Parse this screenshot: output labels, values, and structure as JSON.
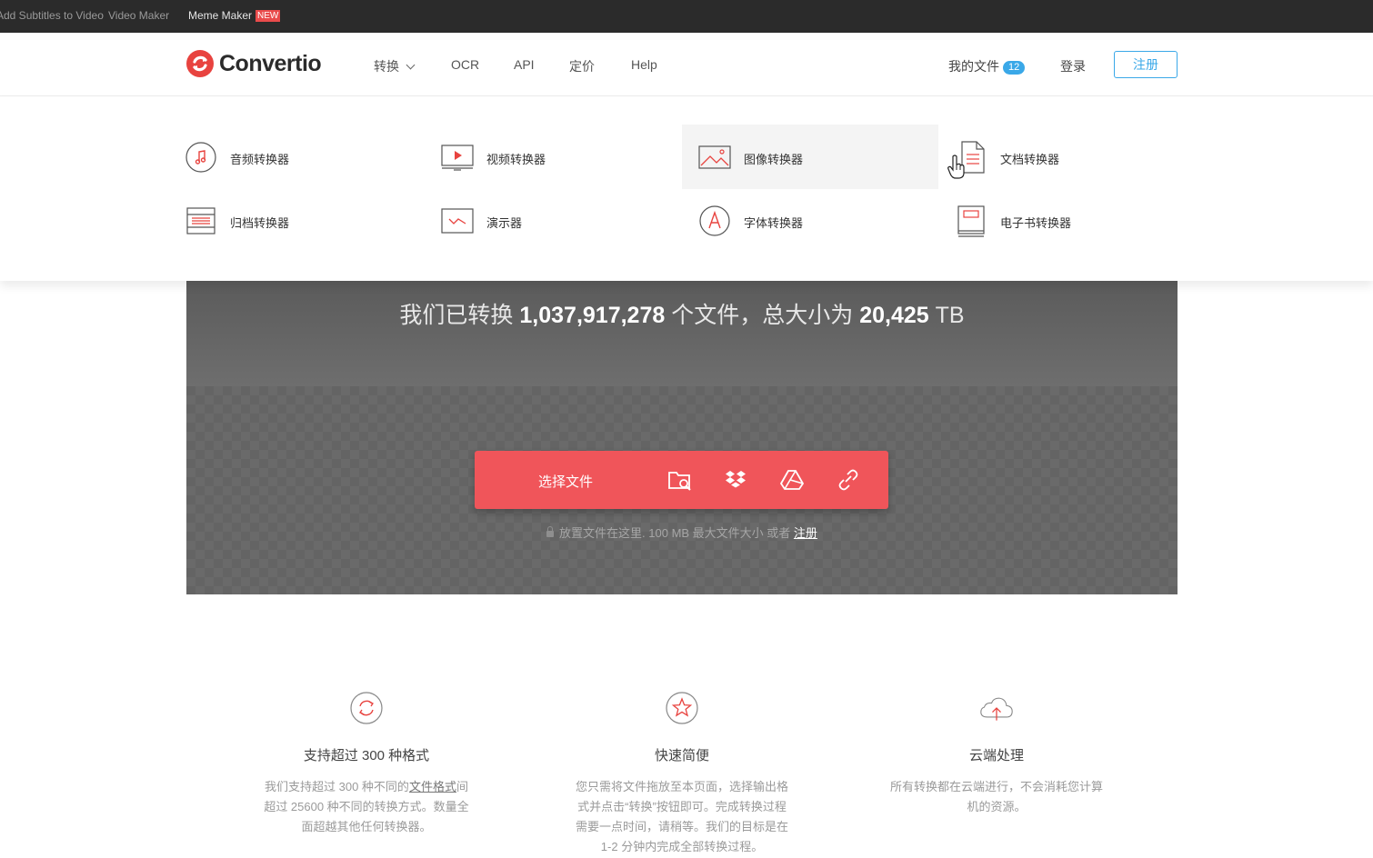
{
  "topbar": {
    "links": [
      "Add Subtitles to Video",
      "Video Maker",
      "Meme Maker"
    ],
    "new_badge": "NEW"
  },
  "header": {
    "brand": "Convertio",
    "nav": {
      "convert": "转换",
      "ocr": "OCR",
      "api": "API",
      "pricing": "定价",
      "help": "Help"
    },
    "my_files": "我的文件",
    "my_files_count": "12",
    "login": "登录",
    "signup": "注册"
  },
  "dropdown": {
    "items": [
      {
        "label": "音频转换器",
        "icon": "music-note-icon"
      },
      {
        "label": "视频转换器",
        "icon": "video-play-icon"
      },
      {
        "label": "图像转换器",
        "icon": "image-icon"
      },
      {
        "label": "文档转换器",
        "icon": "document-icon"
      },
      {
        "label": "归档转换器",
        "icon": "archive-icon"
      },
      {
        "label": "演示器",
        "icon": "presentation-icon"
      },
      {
        "label": "字体转换器",
        "icon": "font-icon"
      },
      {
        "label": "电子书转换器",
        "icon": "ebook-icon"
      }
    ]
  },
  "hero": {
    "stats_prefix": "我们已转换",
    "files_count": "1,037,917,278",
    "stats_mid": "个文件，总大小为",
    "total_size": "20,425",
    "size_unit": "TB",
    "choose_files": "选择文件",
    "hint_text": "放置文件在这里. 100 MB 最大文件大小 或者",
    "hint_link": "注册"
  },
  "features": [
    {
      "title": "支持超过 300 种格式",
      "desc_before": "我们支持超过 300 种不同的",
      "desc_link": "文件格式",
      "desc_after": "间超过 25600 种不同的转换方式。数量全面超越其他任何转换器。",
      "icon": "refresh-icon"
    },
    {
      "title": "快速简便",
      "desc": "您只需将文件拖放至本页面，选择输出格式并点击“转换”按钮即可。完成转换过程需要一点时间，请稍等。我们的目标是在 1-2 分钟内完成全部转换过程。",
      "icon": "star-icon"
    },
    {
      "title": "云端处理",
      "desc": "所有转换都在云端进行，不会消耗您计算机的资源。",
      "icon": "cloud-upload-icon"
    }
  ],
  "colors": {
    "accent": "#f0555a",
    "link_blue": "#3aa8e8",
    "brand_red": "#e8433f"
  }
}
